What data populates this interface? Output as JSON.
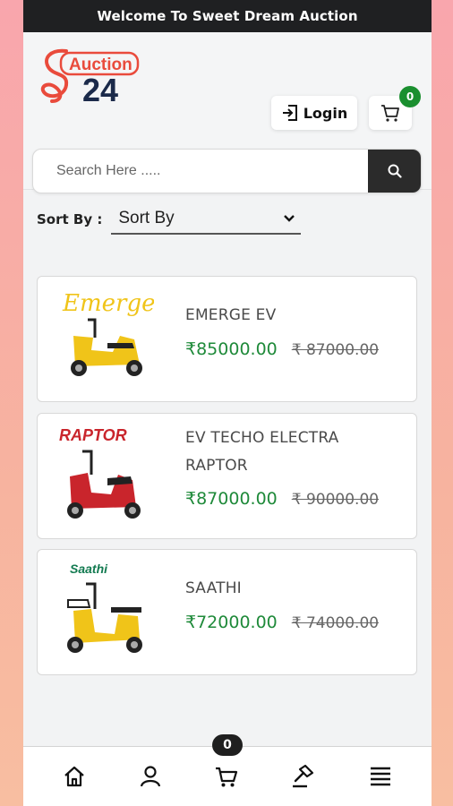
{
  "topbar": {
    "welcome": "Welcome To Sweet Dream Auction"
  },
  "brand": {
    "logo_word": "Auction",
    "logo_number": "24",
    "accent": "#e94b3c",
    "dark": "#1b2a4a"
  },
  "header": {
    "login_label": "Login",
    "cart_count": "0"
  },
  "search": {
    "placeholder": "Search Here ....."
  },
  "sort": {
    "label": "Sort By :",
    "selected": "Sort By"
  },
  "products": [
    {
      "brand_mark": "Emerge",
      "name": "EMERGE EV",
      "price": "₹85000.00",
      "old_price": "₹ 87000.00",
      "scooter_color": "#f0c419"
    },
    {
      "brand_mark": "RAPTOR",
      "name": "EV TECHO ELECTRA RAPTOR",
      "price": "₹87000.00",
      "old_price": "₹ 90000.00",
      "scooter_color": "#c9252c"
    },
    {
      "brand_mark": "Saathi",
      "name": "SAATHI",
      "price": "₹72000.00",
      "old_price": "₹ 74000.00",
      "scooter_color": "#f0c419"
    }
  ],
  "bottom_nav": {
    "items": [
      "home-icon",
      "user-icon",
      "cart-icon",
      "gavel-icon",
      "menu-icon"
    ],
    "cart_count": "0"
  }
}
